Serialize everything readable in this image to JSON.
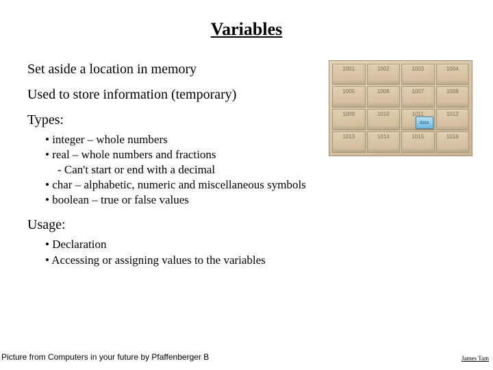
{
  "title": "Variables",
  "p1": "Set aside a location in memory",
  "p2": "Used to store information (temporary)",
  "types_heading": "Types:",
  "types": {
    "b1": "integer – whole numbers",
    "b2": "real – whole numbers and fractions",
    "b2_sub": "Can't start or end with a decimal",
    "b3": "char – alphabetic, numeric and miscellaneous symbols",
    "b4": "boolean – true or false values"
  },
  "usage_heading": "Usage:",
  "usage": {
    "b1": "Declaration",
    "b2": "Accessing or assigning values to the variables"
  },
  "footer_left": "Picture from Computers in your future by Pfaffenberger B",
  "footer_right": "James Tam",
  "memory_cells": [
    "1001",
    "1002",
    "1003",
    "1004",
    "1005",
    "1006",
    "1007",
    "1008",
    "1009",
    "1010",
    "1011",
    "1012",
    "1013",
    "1014",
    "1015",
    "1016"
  ],
  "data_chip_label": "data",
  "data_chip_cell_index": 10
}
